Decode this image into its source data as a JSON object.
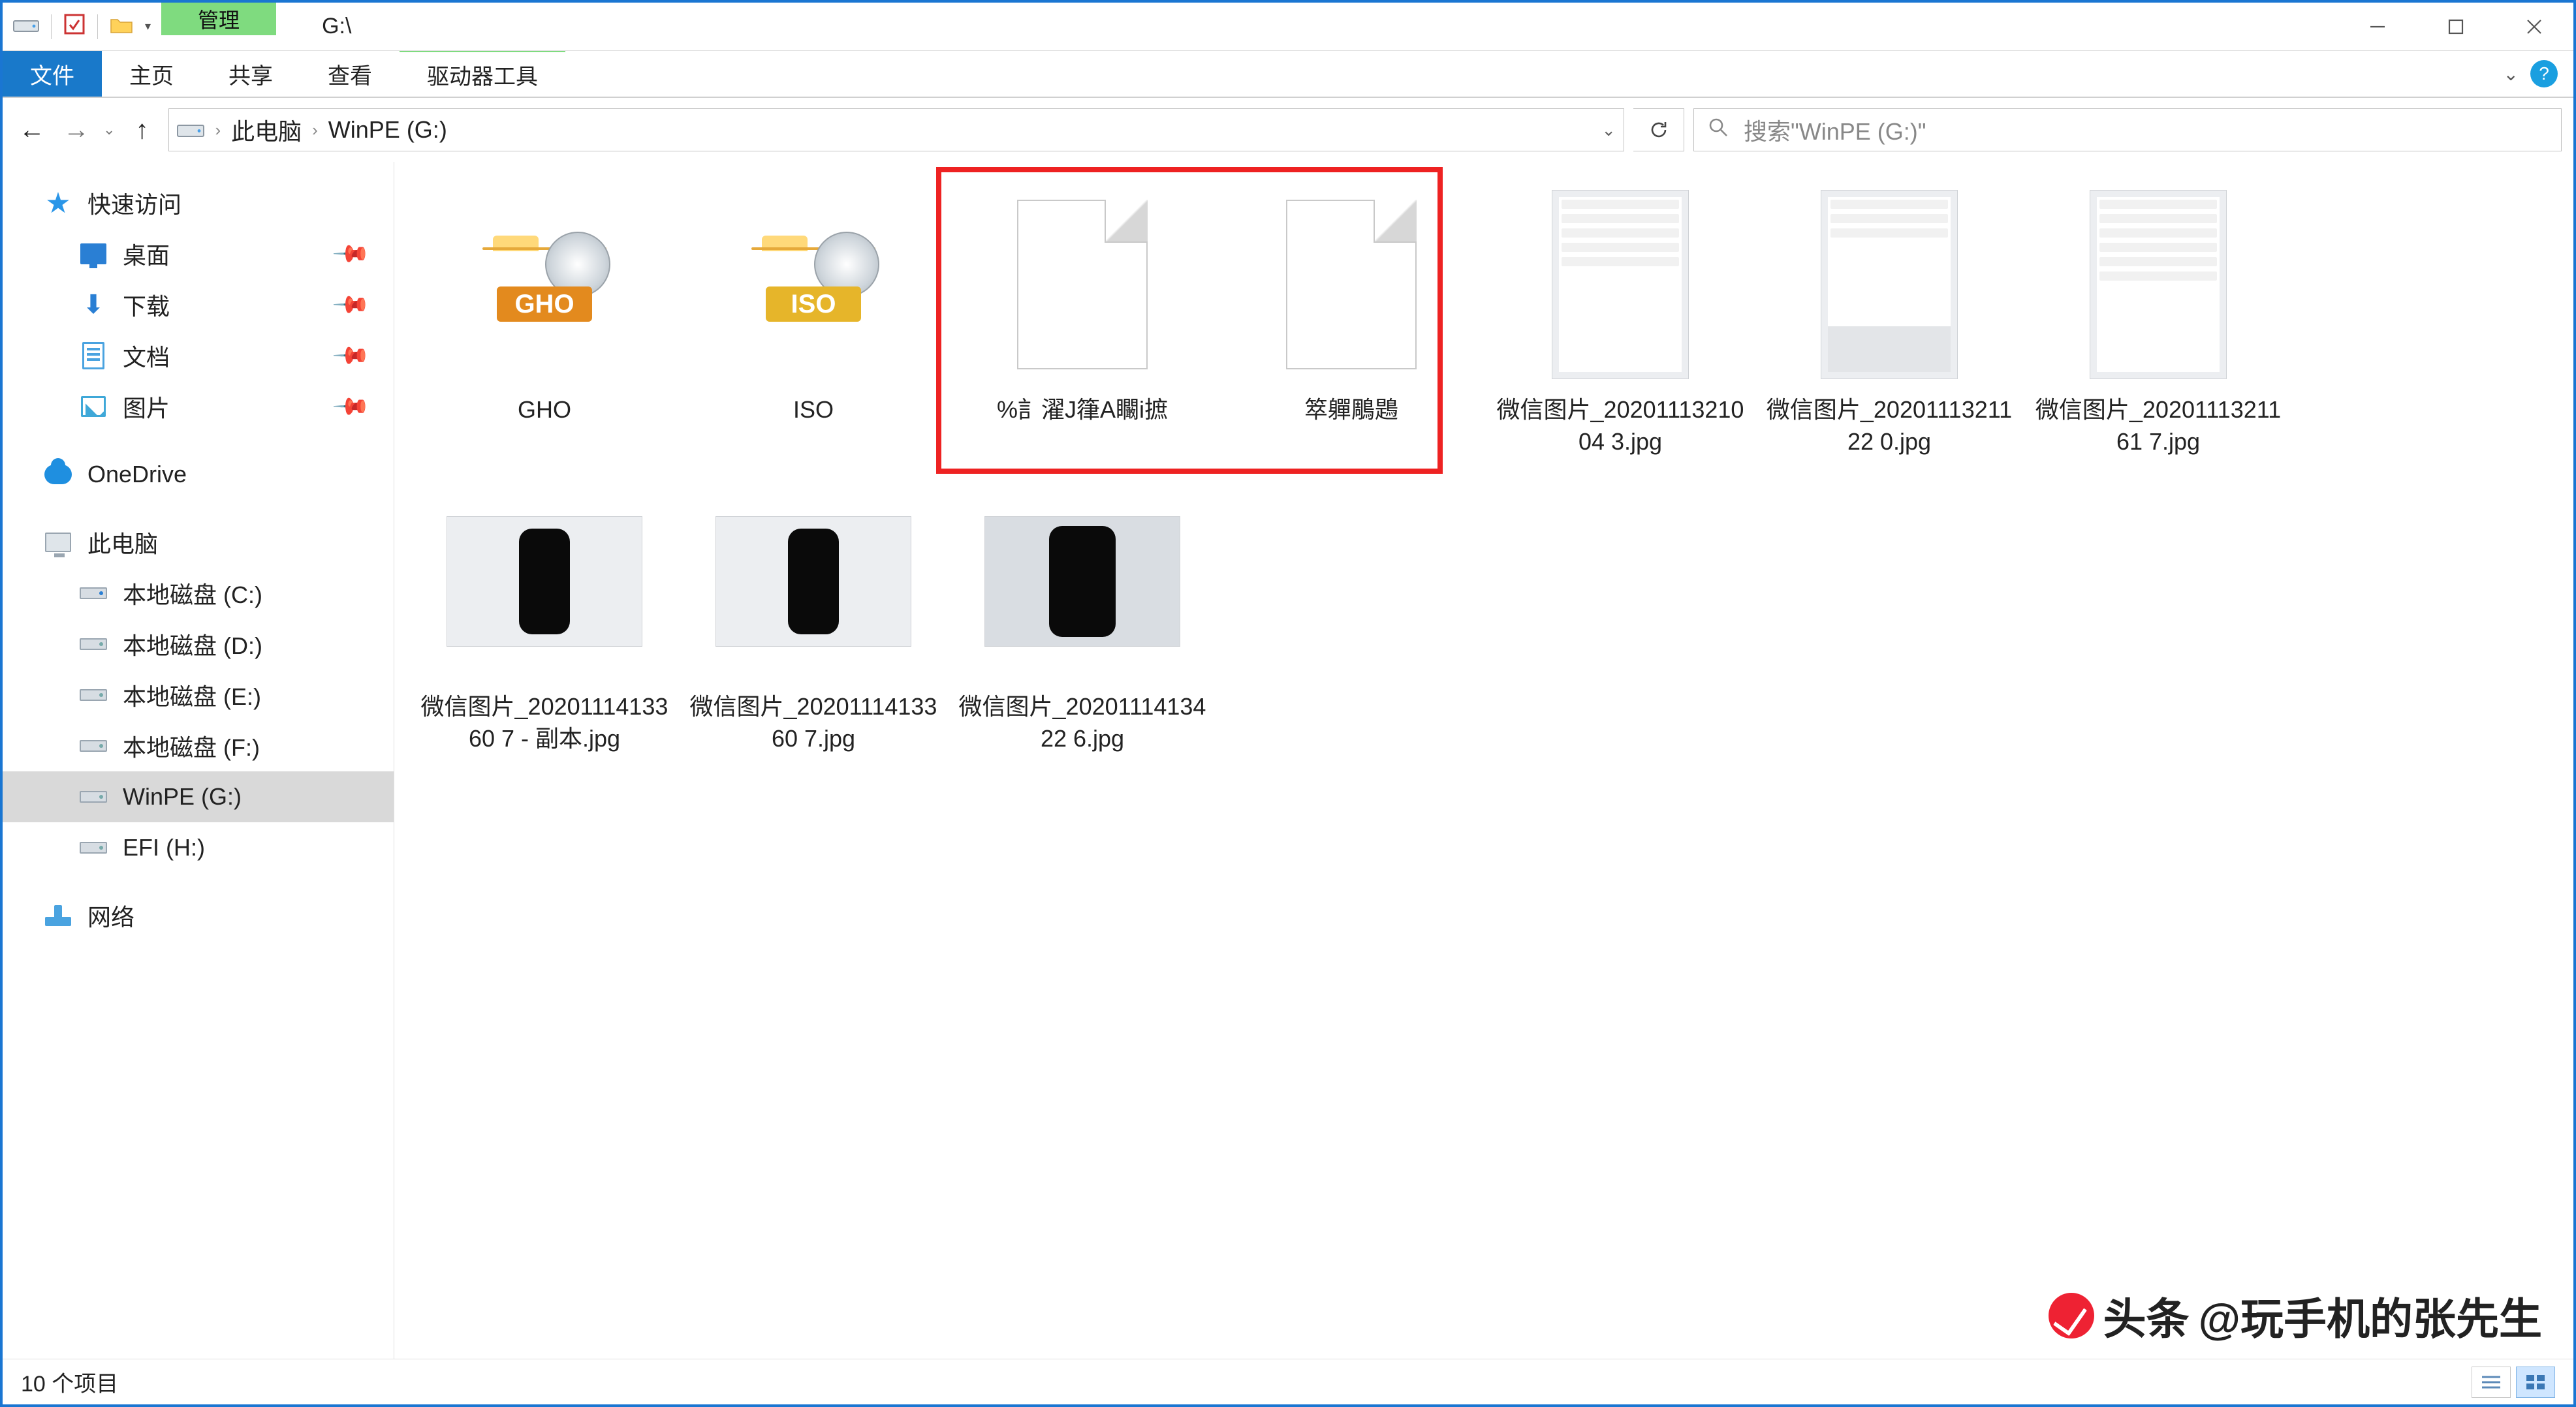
{
  "titlebar": {
    "context_tab": "管理",
    "title_path": "G:\\"
  },
  "window_controls": {
    "min": "–",
    "max": "□",
    "close": "×"
  },
  "ribbon": {
    "file": "文件",
    "home": "主页",
    "share": "共享",
    "view": "查看",
    "drive_tools": "驱动器工具"
  },
  "nav": {
    "back_enabled": true,
    "chev": "›",
    "crumb_root": "此电脑",
    "crumb_current": "WinPE (G:)"
  },
  "search": {
    "placeholder": "搜索\"WinPE (G:)\""
  },
  "sidebar": {
    "quick_access": "快速访问",
    "desktop": "桌面",
    "downloads": "下载",
    "documents": "文档",
    "pictures": "图片",
    "onedrive": "OneDrive",
    "this_pc": "此电脑",
    "drive_c": "本地磁盘 (C:)",
    "drive_d": "本地磁盘 (D:)",
    "drive_e": "本地磁盘 (E:)",
    "drive_f": "本地磁盘 (F:)",
    "drive_g": "WinPE (G:)",
    "drive_h": "EFI (H:)",
    "network": "网络"
  },
  "items": {
    "gho": "GHO",
    "iso": "ISO",
    "garble1": "%訁濯J箻A矙i摭",
    "garble2": "箤軃鵰鶗",
    "img1": "微信图片_2020111321004 3.jpg",
    "img2": "微信图片_2020111321122 0.jpg",
    "img3": "微信图片_2020111321161 7.jpg",
    "img4": "微信图片_2020111413360 7 - 副本.jpg",
    "img5": "微信图片_2020111413360 7.jpg",
    "img6": "微信图片_2020111413422 6.jpg"
  },
  "status": {
    "count": "10 个项目"
  },
  "watermark": {
    "brand": "头条",
    "handle": "@玩手机的张先生"
  }
}
